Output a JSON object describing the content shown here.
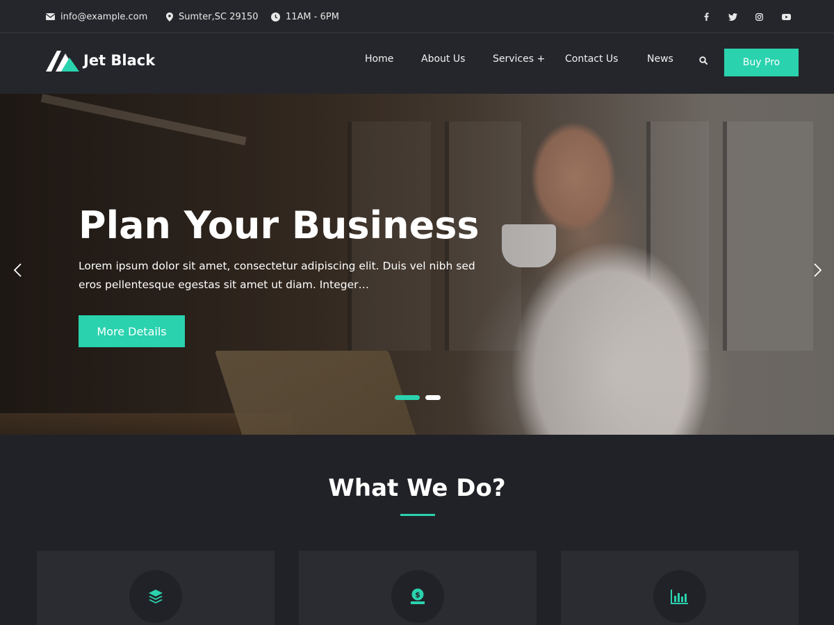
{
  "topbar": {
    "email": "info@example.com",
    "location": "Sumter,SC 29150",
    "hours": "11AM - 6PM",
    "social_icons": [
      "facebook-icon",
      "twitter-icon",
      "instagram-icon",
      "youtube-icon"
    ]
  },
  "header": {
    "logo_text": "Jet Black",
    "nav": [
      "Home",
      "About Us",
      "Services +",
      "Contact Us",
      "News"
    ],
    "buy_label": "Buy Pro"
  },
  "hero": {
    "title": "Plan Your Business",
    "description": "Lorem ipsum dolor sit amet, consectetur adipiscing elit. Duis vel nibh sed eros pellentesque egestas sit amet ut diam. Integer…",
    "button_label": "More Details",
    "slides": 2,
    "active_slide": 1
  },
  "services": {
    "title": "What We Do?",
    "cards": [
      {
        "icon": "layers-icon"
      },
      {
        "icon": "money-bag-icon"
      },
      {
        "icon": "bar-chart-icon"
      }
    ]
  },
  "colors": {
    "accent": "#2ad2ae",
    "background": "#212227",
    "header": "#24262b",
    "card": "#2b2c31"
  }
}
